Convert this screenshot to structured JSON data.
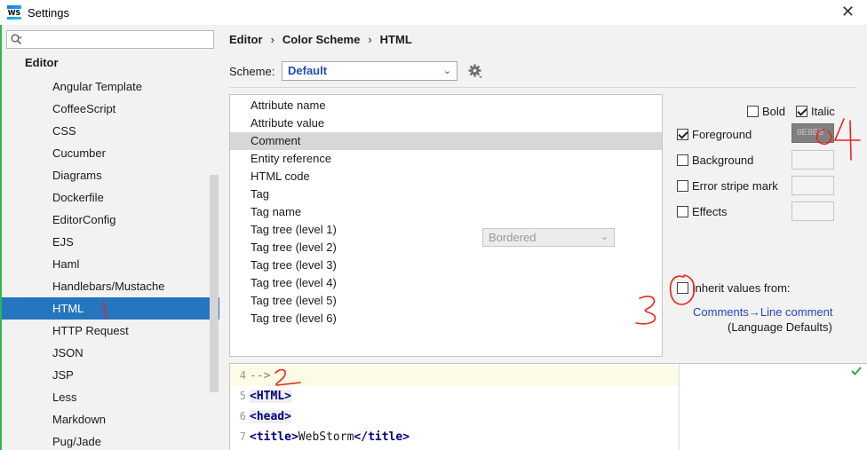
{
  "window": {
    "title": "Settings",
    "app_icon_label": "WS",
    "close_glyph": "✕"
  },
  "sidebar": {
    "search_placeholder": "",
    "section_title": "Editor",
    "items": [
      {
        "label": "Angular Template"
      },
      {
        "label": "CoffeeScript"
      },
      {
        "label": "CSS"
      },
      {
        "label": "Cucumber"
      },
      {
        "label": "Diagrams"
      },
      {
        "label": "Dockerfile"
      },
      {
        "label": "EditorConfig"
      },
      {
        "label": "EJS"
      },
      {
        "label": "Haml"
      },
      {
        "label": "Handlebars/Mustache"
      },
      {
        "label": "HTML",
        "selected": true
      },
      {
        "label": "HTTP Request"
      },
      {
        "label": "JSON"
      },
      {
        "label": "JSP"
      },
      {
        "label": "Less"
      },
      {
        "label": "Markdown"
      },
      {
        "label": "Pug/Jade"
      }
    ]
  },
  "breadcrumb": {
    "part1": "Editor",
    "part2": "Color Scheme",
    "part3": "HTML",
    "separator": "›"
  },
  "scheme": {
    "label": "Scheme:",
    "value": "Default",
    "chevron": "⌄"
  },
  "attributes": [
    "Attribute name",
    "Attribute value",
    "Comment",
    "Entity reference",
    "HTML code",
    "Tag",
    "Tag name",
    "Tag tree (level 1)",
    "Tag tree (level 2)",
    "Tag tree (level 3)",
    "Tag tree (level 4)",
    "Tag tree (level 5)",
    "Tag tree (level 6)"
  ],
  "selected_attribute": "Comment",
  "options": {
    "bold_label": "Bold",
    "bold_checked": false,
    "italic_label": "Italic",
    "italic_checked": true,
    "foreground_label": "Foreground",
    "foreground_checked": true,
    "foreground_value": "8E8E8E",
    "foreground_swatch_text": "8E8E8",
    "background_label": "Background",
    "background_checked": false,
    "error_stripe_label": "Error stripe mark",
    "error_stripe_checked": false,
    "effects_label": "Effects",
    "effects_checked": false,
    "effects_type": "Bordered",
    "inherit_label": "Inherit values from:",
    "inherit_checked": false,
    "inherit_link": "Comments→Line comment",
    "inherit_note": "(Language Defaults)"
  },
  "preview": {
    "lines": [
      {
        "num": "4",
        "text": "-->"
      },
      {
        "num": "5",
        "tag": "<HTML>"
      },
      {
        "num": "6",
        "tag": "<head>"
      },
      {
        "num": "7",
        "tag_open": "<title>",
        "text": "WebStorm",
        "tag_close": "</title>"
      }
    ]
  },
  "colors": {
    "selection": "#2675bf",
    "accent_link": "#2246c7",
    "annotation_red": "#e8241c"
  },
  "annotations": [
    "1",
    "2",
    "3",
    "4"
  ]
}
